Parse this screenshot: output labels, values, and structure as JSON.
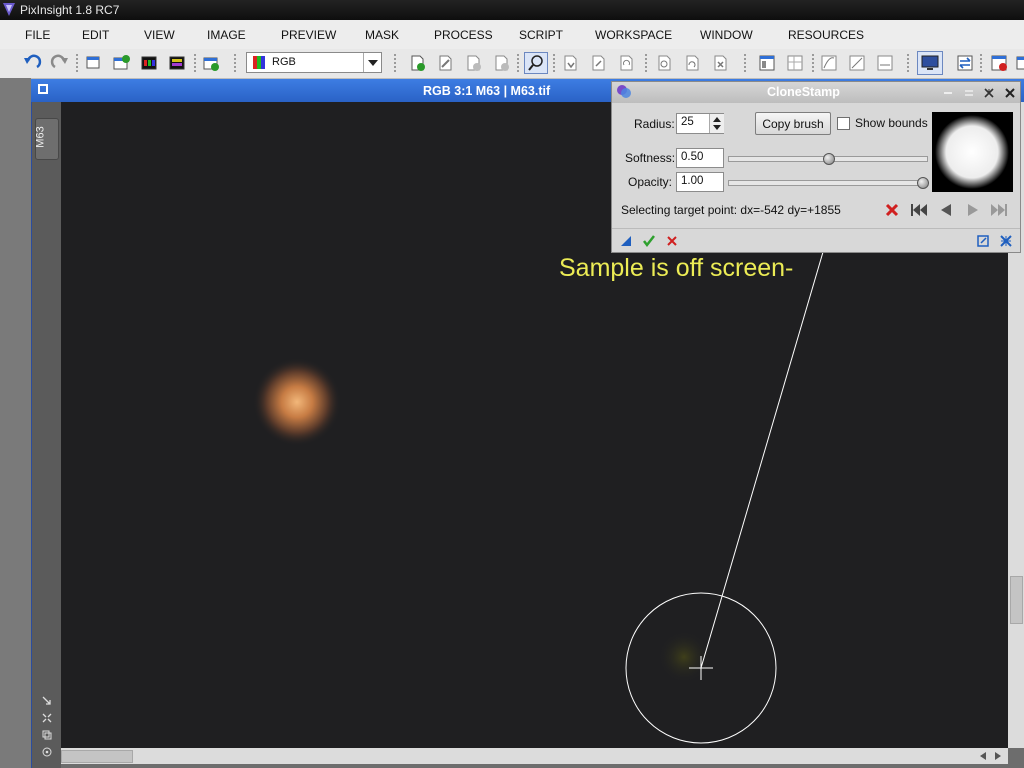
{
  "app": {
    "title": "PixInsight 1.8 RC7"
  },
  "menu": [
    "FILE",
    "EDIT",
    "VIEW",
    "IMAGE",
    "PREVIEW",
    "MASK",
    "PROCESS",
    "SCRIPT",
    "WORKSPACE",
    "WINDOW",
    "RESOURCES"
  ],
  "toolbar": {
    "channel_select": "RGB"
  },
  "image_window": {
    "title": "RGB 3:1 M63 | M63.tif",
    "tab_label": "M63"
  },
  "clone_stamp": {
    "title": "CloneStamp",
    "radius_label": "Radius:",
    "radius_value": "25",
    "copy_brush_label": "Copy brush",
    "show_bounds_label": "Show bounds",
    "show_bounds_checked": false,
    "softness_label": "Softness:",
    "softness_value": "0.50",
    "opacity_label": "Opacity:",
    "opacity_value": "1.00",
    "status": "Selecting target point: dx=-542 dy=+1855"
  },
  "overlay": {
    "message": "Sample is off screen-"
  },
  "colors": {
    "window_title": "#2f6fd6",
    "overlay_text": "#ecec55",
    "delete_red": "#d02020",
    "check_green": "#2ea02e"
  }
}
